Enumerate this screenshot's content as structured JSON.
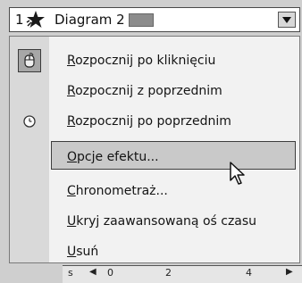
{
  "header": {
    "order_number": "1",
    "effect_icon": "star-effect-icon",
    "title": "Diagram 2",
    "swatch_color": "#8c8c8c",
    "dropdown_icon": "chevron-down-icon"
  },
  "menu": {
    "items": [
      {
        "pre": "",
        "ul": "R",
        "post": "ozpocznij po kliknięciu",
        "icon": "mouse-click-icon"
      },
      {
        "pre": "",
        "ul": "R",
        "post": "ozpocznij z poprzednim",
        "icon": ""
      },
      {
        "pre": "",
        "ul": "R",
        "post": "ozpocznij po poprzednim",
        "icon": "clock-icon"
      },
      {
        "pre": "",
        "ul": "O",
        "post": "pcje efektu...",
        "icon": "",
        "highlighted": true
      },
      {
        "pre": "",
        "ul": "C",
        "post": "hronometraż...",
        "icon": ""
      },
      {
        "pre": "",
        "ul": "U",
        "post": "kryj zaawansowaną oś czasu",
        "icon": ""
      },
      {
        "pre": "",
        "ul": "U",
        "post": "suń",
        "icon": ""
      }
    ]
  },
  "timeline": {
    "ticks": [
      "s",
      "0",
      "2",
      "4"
    ]
  }
}
